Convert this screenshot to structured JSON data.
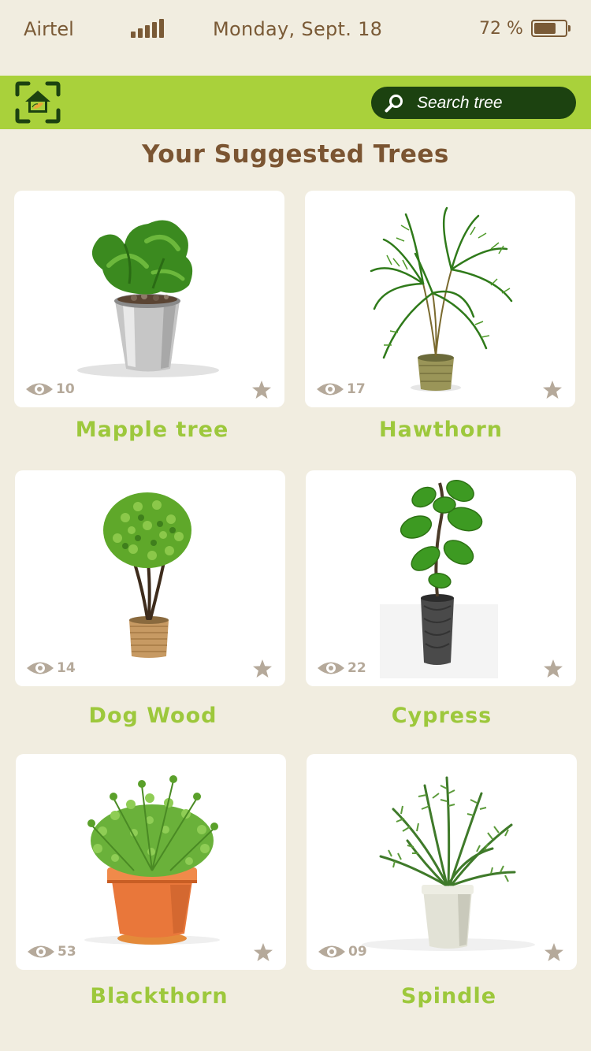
{
  "status_bar": {
    "carrier": "Airtel",
    "date": "Monday, Sept. 18",
    "battery_percent": "72 %",
    "battery_level": 0.72,
    "signal_icon": "signal-bars-icon",
    "battery_icon": "battery-icon"
  },
  "header": {
    "logo_icon": "plant-home-scan-icon",
    "search": {
      "placeholder": "Search tree",
      "value": "",
      "icon": "search-icon"
    }
  },
  "colors": {
    "background": "#f1ede0",
    "header_green": "#a9d13b",
    "search_dark_green": "#1c4210",
    "title_brown": "#7b5532",
    "plant_name_green": "#9dc83c",
    "meta_gray": "#b5a99a"
  },
  "page_title": "Your Suggested Trees",
  "trees": [
    {
      "name": "Mapple tree",
      "views": "10",
      "view_icon": "eye-icon",
      "favorite_icon": "star-icon"
    },
    {
      "name": "Hawthorn",
      "views": "17",
      "view_icon": "eye-icon",
      "favorite_icon": "star-icon"
    },
    {
      "name": "Dog Wood",
      "views": "14",
      "view_icon": "eye-icon",
      "favorite_icon": "star-icon"
    },
    {
      "name": "Cypress",
      "views": "22",
      "view_icon": "eye-icon",
      "favorite_icon": "star-icon"
    },
    {
      "name": "Blackthorn",
      "views": "53",
      "view_icon": "eye-icon",
      "favorite_icon": "star-icon"
    },
    {
      "name": "Spindle",
      "views": "09",
      "view_icon": "eye-icon",
      "favorite_icon": "star-icon"
    }
  ]
}
